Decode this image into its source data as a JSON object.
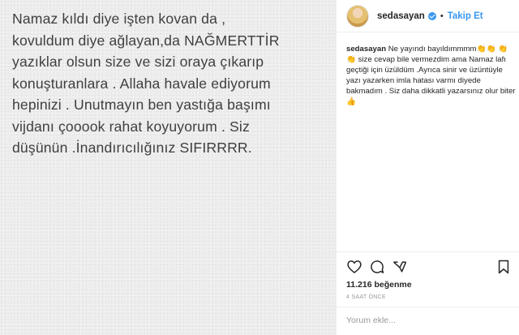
{
  "post": {
    "text_lines": [
      "Namaz kıldı diye işten kovan da ,",
      "kovuldum diye ağlayan,da NAĞMERTTİR",
      "yazıklar olsun size ve sizi oraya çıkarıp",
      "konuşturanlara . Allaha havale ediyorum",
      "hepinizi . Unutmayın ben yastığa başımı",
      "vijdanı çooook rahat koyuyorum . Siz",
      "düşünün .İnandırıcılığınız SIFIRRRR."
    ]
  },
  "header": {
    "username": "sedasayan",
    "separator": "•",
    "follow_label": "Takip Et",
    "verified_icon": "verified-badge-icon"
  },
  "caption": {
    "username": "sedasayan",
    "part1": "Ne yayındı bayıldımmmm",
    "claps1": "👏👏",
    "claps2": "👏👏",
    "part2": "size cevap bile vermezdim ama Namaz lafı geçtiği için üzüldüm .Ayrıca sinir ve üzüntüyle yazı yazarken imla hatası varmı diyede bakmadım . Siz daha dikkatli yazarsınız olur biter",
    "thumb": "👍"
  },
  "actions": {
    "icons": [
      "heart-icon",
      "comment-icon",
      "share-icon",
      "bookmark-icon"
    ]
  },
  "likes_text": "11.216 beğenme",
  "timestamp": "4 SAAT ÖNCE",
  "comment": {
    "placeholder": "Yorum ekle..."
  },
  "colors": {
    "accent": "#3897f0",
    "text": "#262626",
    "muted": "#999999",
    "post_bg": "#ededed"
  }
}
